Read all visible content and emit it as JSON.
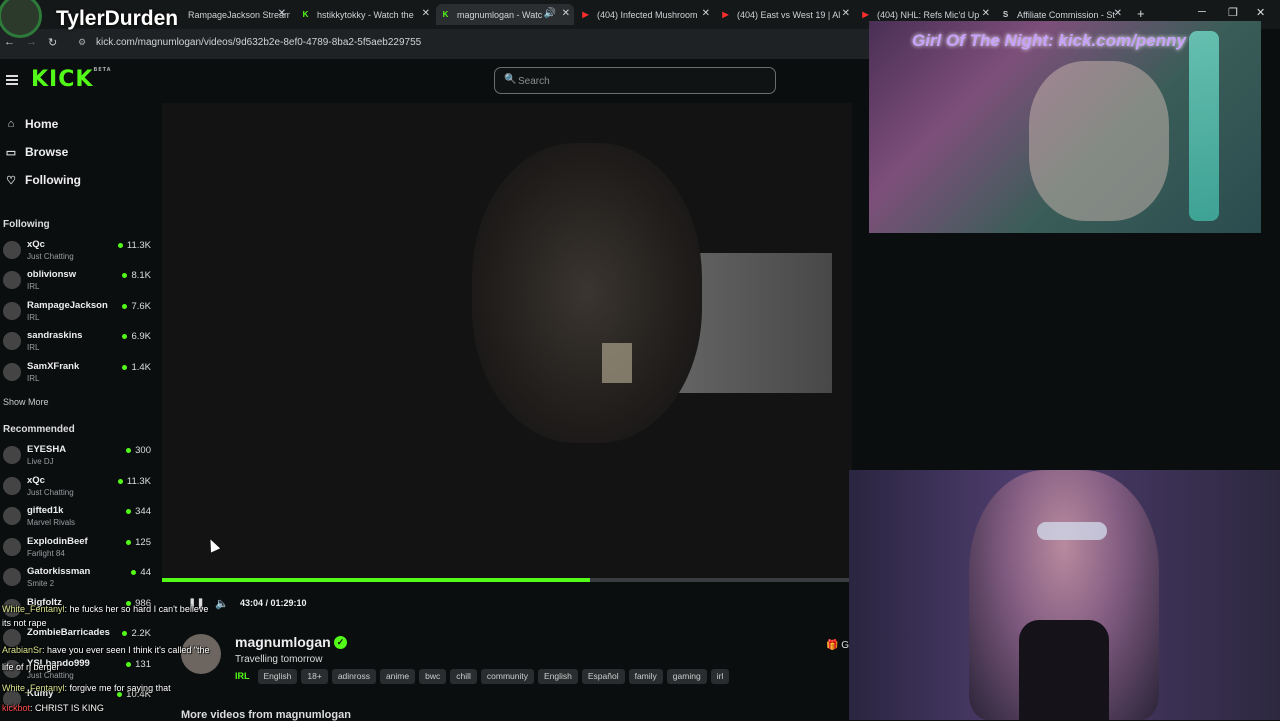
{
  "browser": {
    "tabs": [
      {
        "title": "RampageJackson Stream",
        "color": "#53fc18",
        "fav": "K"
      },
      {
        "title": "hstikkytokky - Watch the",
        "color": "#53fc18",
        "fav": "K"
      },
      {
        "title": "magnumlogan - Watc",
        "color": "#53fc18",
        "fav": "K"
      },
      {
        "title": "(404) Infected Mushroom",
        "color": "#ff2d2d",
        "fav": "▶"
      },
      {
        "title": "(404) East vs West 19 | Al",
        "color": "#ff2d2d",
        "fav": "▶"
      },
      {
        "title": "(404) NHL: Refs Mic'd Up",
        "color": "#ff2d2d",
        "fav": "▶"
      },
      {
        "title": "Affiliate Commission - St",
        "color": "#cfd3d6",
        "fav": "S"
      }
    ],
    "new_tab": "+",
    "url": "kick.com/magnumlogan/videos/9d632b2e-8ef0-4789-8ba2-5f5aeb229755"
  },
  "streamer_overlay": {
    "name": "TylerDurden"
  },
  "header": {
    "logo": "KICK",
    "logo_badge": "BETA",
    "search_placeholder": "Search"
  },
  "sidebar": {
    "nav": [
      {
        "label": "Home",
        "icon": "⌂"
      },
      {
        "label": "Browse",
        "icon": "▭"
      },
      {
        "label": "Following",
        "icon": "♡"
      }
    ],
    "following_title": "Following",
    "following": [
      {
        "name": "xQc",
        "category": "Just Chatting",
        "viewers": "11.3K"
      },
      {
        "name": "oblivionsw",
        "category": "IRL",
        "viewers": "8.1K"
      },
      {
        "name": "RampageJackson",
        "category": "IRL",
        "viewers": "7.6K"
      },
      {
        "name": "sandraskins",
        "category": "IRL",
        "viewers": "6.9K"
      },
      {
        "name": "SamXFrank",
        "category": "IRL",
        "viewers": "1.4K"
      }
    ],
    "show_more": "Show More",
    "recommended_title": "Recommended",
    "recommended": [
      {
        "name": "EYESHA",
        "category": "Live DJ",
        "viewers": "300"
      },
      {
        "name": "xQc",
        "category": "Just Chatting",
        "viewers": "11.3K"
      },
      {
        "name": "gifted1k",
        "category": "Marvel Rivals",
        "viewers": "344"
      },
      {
        "name": "ExplodinBeef",
        "category": "Farlight 84",
        "viewers": "125"
      },
      {
        "name": "Gatorkissman",
        "category": "Smite 2",
        "viewers": "44"
      },
      {
        "name": "Bigfoltz",
        "category": "",
        "viewers": "986"
      },
      {
        "name": "ZombieBarricades",
        "category": "",
        "viewers": "2.2K"
      },
      {
        "name": "YSLbando999",
        "category": "Just Chatting",
        "viewers": "131"
      },
      {
        "name": "Kumy",
        "category": "",
        "viewers": "10.4K"
      }
    ]
  },
  "player": {
    "time": "43:04 / 01:29:10",
    "progress": 0.62
  },
  "stream": {
    "channel": "magnumlogan",
    "title": "Travelling tomorrow",
    "category": "IRL",
    "tags": [
      "English",
      "18+",
      "adinross",
      "anime",
      "bwc",
      "chill",
      "community",
      "English",
      "Español",
      "family",
      "gaming",
      "irl"
    ],
    "gift_label": "G",
    "more_videos": "More videos from magnumlogan"
  },
  "overlay_top": {
    "text": "Girl Of The Night: kick.com/penny"
  },
  "chat": [
    {
      "user": "White_Fentanyl",
      "text": ": he fucks her so hard I can't believe"
    },
    {
      "user": "",
      "text": "its not rape"
    },
    {
      "user": "ArabianSr",
      "text": ": have you ever seen I think it's called \"the"
    },
    {
      "user": "",
      "text": "life of rj berger\""
    },
    {
      "user": "White_Fentanyl",
      "text": ": forgive me for saying that"
    },
    {
      "user": "kickbot",
      "text": ": CHRIST IS KING"
    }
  ]
}
